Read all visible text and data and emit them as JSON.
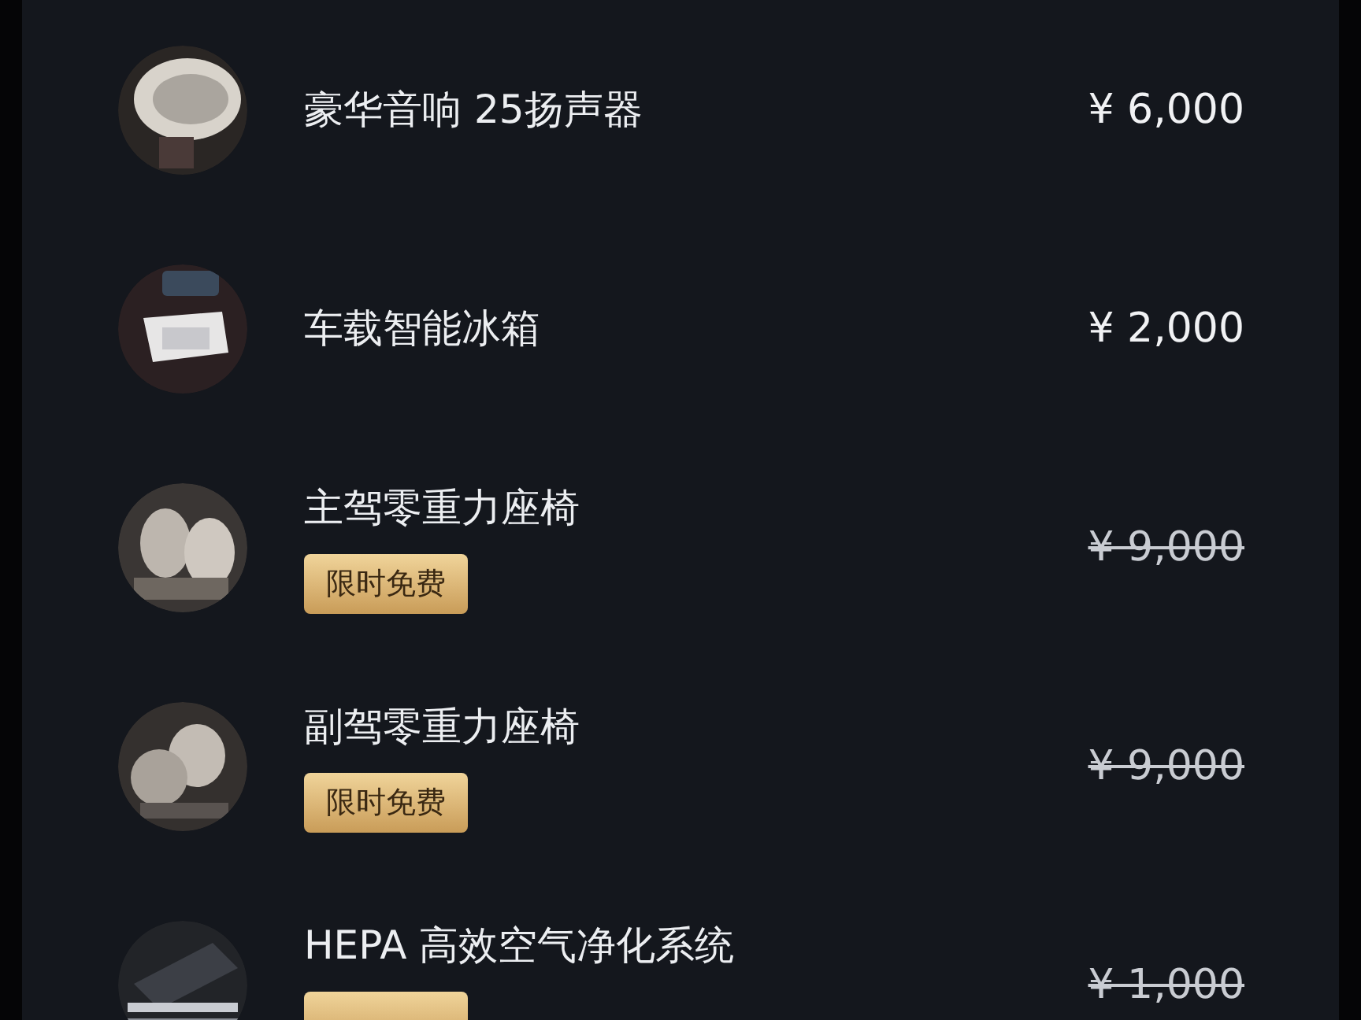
{
  "options": [
    {
      "title": "豪华音响 25扬声器",
      "price": "¥ 6,000",
      "promo": false
    },
    {
      "title": "车载智能冰箱",
      "price": "¥ 2,000",
      "promo": false
    },
    {
      "title": "主驾零重力座椅",
      "price": "¥ 9,000",
      "promo": true,
      "badge": "限时免费"
    },
    {
      "title": "副驾零重力座椅",
      "price": "¥ 9,000",
      "promo": true,
      "badge": "限时免费"
    },
    {
      "title": "HEPA 高效空气净化系统",
      "price": "¥ 1,000",
      "promo": true
    }
  ]
}
